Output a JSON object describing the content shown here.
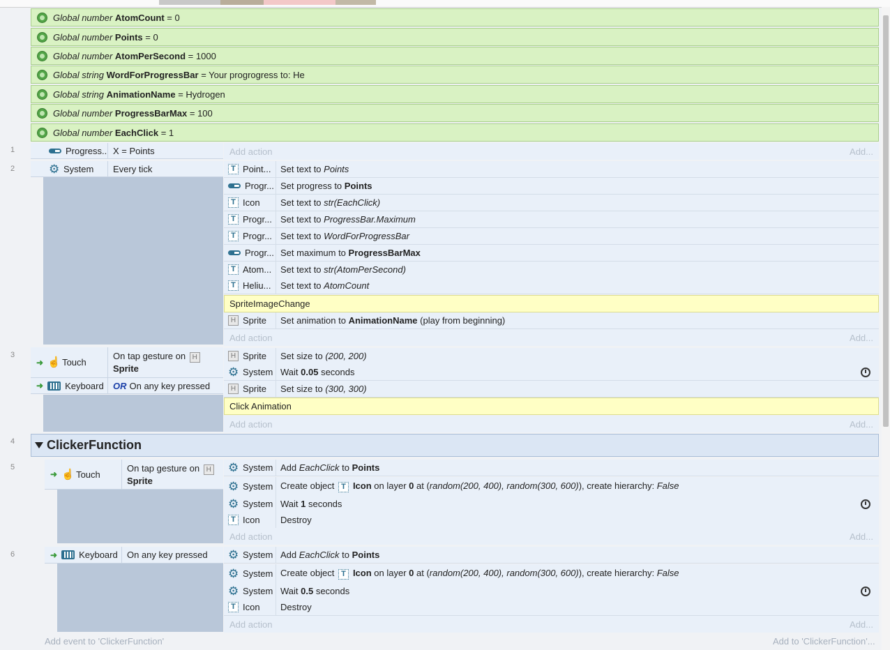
{
  "global_vars": [
    {
      "kind": "Global number",
      "name": "AtomCount",
      "value": "= 0"
    },
    {
      "kind": "Global number",
      "name": "Points",
      "value": "= 0"
    },
    {
      "kind": "Global number",
      "name": "AtomPerSecond",
      "value": "= 1000"
    },
    {
      "kind": "Global string",
      "name": "WordForProgressBar",
      "value": "= Your progrogress to: He"
    },
    {
      "kind": "Global string",
      "name": "AnimationName",
      "value": "= Hydrogen"
    },
    {
      "kind": "Global number",
      "name": "ProgressBarMax",
      "value": "= 100"
    },
    {
      "kind": "Global number",
      "name": "EachClick",
      "value": "= 1"
    }
  ],
  "line_numbers": [
    "1",
    "2",
    "3",
    "4",
    "5",
    "6"
  ],
  "add_action_label": "Add action",
  "add_label": "Add...",
  "event1": {
    "cond_object": "Progress...",
    "cond_text": "X = Points"
  },
  "event2": {
    "cond_object": "System",
    "cond_text": "Every tick",
    "actions": [
      {
        "obj": "Point...",
        "t1": "Set text to ",
        "i1": "Points"
      },
      {
        "obj": "Progr...",
        "t1": "Set progress to ",
        "b1": "Points"
      },
      {
        "obj": "Icon",
        "t1": "Set text to ",
        "i1": "str(EachClick)"
      },
      {
        "obj": "Progr...",
        "t1": "Set text to ",
        "i1": "ProgressBar.Maximum"
      },
      {
        "obj": "Progr...",
        "t1": "Set text to ",
        "i1": "WordForProgressBar"
      },
      {
        "obj": "Progr...",
        "t1": "Set maximum to ",
        "b1": "ProgressBarMax"
      },
      {
        "obj": "Atom...",
        "t1": "Set text to ",
        "i1": "str(AtomPerSecond)"
      },
      {
        "obj": "Heliu...",
        "t1": "Set text to ",
        "i1": "AtomCount"
      }
    ],
    "comment": "SpriteImageChange",
    "sprite_action": {
      "obj": "Sprite",
      "t1": "Set animation to ",
      "b1": "AnimationName",
      "t2": " (play from beginning)"
    }
  },
  "event3": {
    "cond1_object": "Touch",
    "cond1_text": "On tap gesture on",
    "cond1_target": "Sprite",
    "cond2_object": "Keyboard",
    "cond2_or": "OR",
    "cond2_text": "On any key pressed",
    "actions": [
      {
        "obj": "Sprite",
        "t1": "Set size to ",
        "i1": "(200, 200)"
      },
      {
        "obj": "System",
        "t1": "Wait ",
        "b1": "0.05",
        "t2": " seconds"
      },
      {
        "obj": "Sprite",
        "t1": "Set size to ",
        "i1": "(300, 300)"
      }
    ],
    "comment": "Click Animation"
  },
  "group": {
    "title": "ClickerFunction"
  },
  "event5": {
    "cond_object": "Touch",
    "cond_text": "On tap gesture on",
    "cond_target": "Sprite",
    "a1": {
      "obj": "System",
      "t1": "Add ",
      "i1": "EachClick",
      "t2": " to ",
      "b1": "Points"
    },
    "a2": {
      "obj": "System",
      "t1": "Create object ",
      "b1": "Icon",
      "t2": " on layer ",
      "b2": "0",
      "t3": " at (",
      "i1": "random(200, 400), random(300, 600)",
      "t4": "), create hierarchy: ",
      "i2": "False"
    },
    "a3": {
      "obj": "System",
      "t1": "Wait ",
      "b1": "1",
      "t2": " seconds"
    },
    "a4": {
      "obj": "Icon",
      "t1": "Destroy"
    }
  },
  "event6": {
    "cond_object": "Keyboard",
    "cond_text": "On any key pressed",
    "a1": {
      "obj": "System",
      "t1": "Add ",
      "i1": "EachClick",
      "t2": " to ",
      "b1": "Points"
    },
    "a2": {
      "obj": "System",
      "t1": "Create object ",
      "b1": "Icon",
      "t2": " on layer ",
      "b2": "0",
      "t3": " at (",
      "i1": "random(200, 400), random(300, 600)",
      "t4": "), create hierarchy: ",
      "i2": "False"
    },
    "a3": {
      "obj": "System",
      "t1": "Wait ",
      "b1": "0.5",
      "t2": " seconds"
    },
    "a4": {
      "obj": "Icon",
      "t1": "Destroy"
    }
  },
  "footer": {
    "add_event": "Add event to 'ClickerFunction'",
    "add_to": "Add to 'ClickerFunction'..."
  },
  "icons": {
    "text": "text-object-icon",
    "progress": "progressbar-icon",
    "sprite": "sprite-icon",
    "system": "gear-icon",
    "touch": "touch-icon",
    "keyboard": "keyboard-icon",
    "global": "globe-icon",
    "wait": "timer-icon"
  },
  "colors": {
    "global_var_bg": "#d9f2c3",
    "event_bg": "#e9f0f9",
    "comment_bg": "#ffffc5",
    "accent": "#2c6f8f"
  }
}
